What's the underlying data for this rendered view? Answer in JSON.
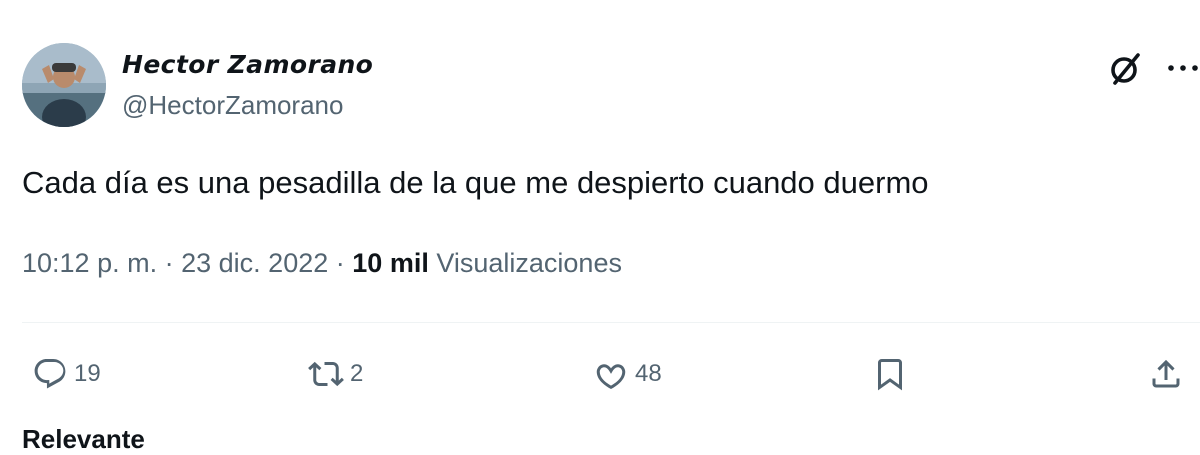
{
  "author": {
    "display_name": "Hector Zamorano",
    "handle": "@HectorZamorano"
  },
  "tweet": {
    "text": "Cada día es una pesadilla de la que me despierto cuando duermo",
    "time": "10:12 p. m.",
    "date": "23 dic. 2022",
    "views_count": "10 mil",
    "views_label": "Visualizaciones",
    "separator": "·"
  },
  "actions": {
    "replies": "19",
    "reposts": "2",
    "likes": "48"
  },
  "footer": {
    "sort_label": "Relevante"
  },
  "icons": [
    "grok-icon",
    "more-icon",
    "reply-icon",
    "repost-icon",
    "like-icon",
    "bookmark-icon",
    "share-icon"
  ],
  "colors": {
    "text_primary": "#0f1419",
    "text_secondary": "#536471",
    "divider": "#eff3f4"
  }
}
